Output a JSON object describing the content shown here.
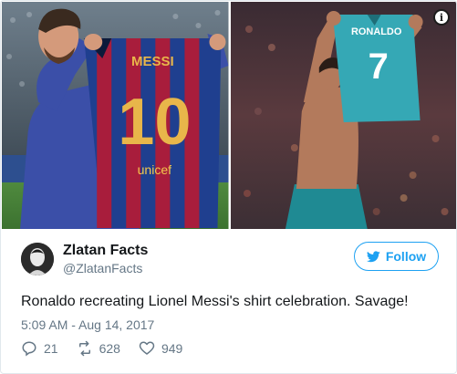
{
  "media": {
    "left": {
      "shirt_name": "MESSI",
      "shirt_number": "10",
      "sponsor": "unicef"
    },
    "right": {
      "shirt_name": "RONALDO",
      "shirt_number": "7"
    },
    "info_icon": "i"
  },
  "author": {
    "display_name": "Zlatan Facts",
    "handle": "@ZlatanFacts"
  },
  "follow": {
    "label": "Follow",
    "icon": "twitter-bird-icon"
  },
  "tweet": {
    "text": "Ronaldo recreating Lionel Messi's shirt celebration. Savage!",
    "timestamp": "5:09 AM - Aug 14, 2017"
  },
  "actions": {
    "replies": "21",
    "retweets": "628",
    "likes": "949"
  },
  "colors": {
    "accent": "#1da1f2",
    "secondary_text": "#657786",
    "primary_text": "#14171a",
    "border": "#e1e8ed"
  }
}
